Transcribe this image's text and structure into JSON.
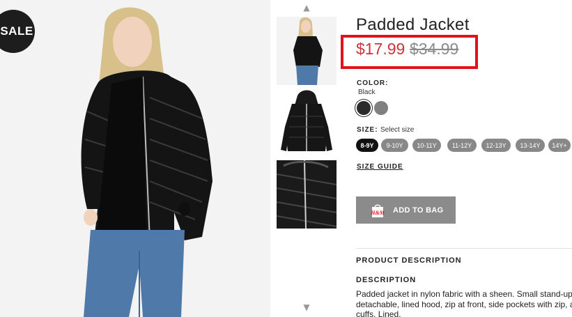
{
  "badge": {
    "sale": "SALE"
  },
  "product": {
    "title": "Padded Jacket",
    "price_sale": "$17.99",
    "price_original": "$34.99"
  },
  "color": {
    "label": "COLOR:",
    "selected": "Black",
    "swatches": [
      {
        "name": "black",
        "hex": "#2b2b2b"
      },
      {
        "name": "grey",
        "hex": "#808080"
      }
    ]
  },
  "size": {
    "label": "SIZE:",
    "hint": "Select size",
    "options": [
      "8-9Y",
      "9-10Y",
      "10-11Y",
      "11-12Y",
      "12-13Y",
      "13-14Y",
      "14Y+"
    ],
    "selected": "8-9Y"
  },
  "size_guide": "SIZE GUIDE",
  "add_to_bag": {
    "label": "ADD TO BAG",
    "logo": "H&M"
  },
  "sections": {
    "product_description": "PRODUCT DESCRIPTION",
    "description": "DESCRIPTION",
    "description_text": "Padded jacket in nylon fabric with a sheen. Small stand-up\ndetachable, lined hood, zip at front, side pockets with zip, a\ncuffs. Lined."
  },
  "icons": {
    "thumb_up": "chevron-up-icon",
    "thumb_down": "chevron-down-icon",
    "bag": "shopping-bag-icon"
  },
  "colors": {
    "sale_red": "#d0333a",
    "highlight": "#e0121b",
    "button_grey": "#8b8b8b"
  }
}
